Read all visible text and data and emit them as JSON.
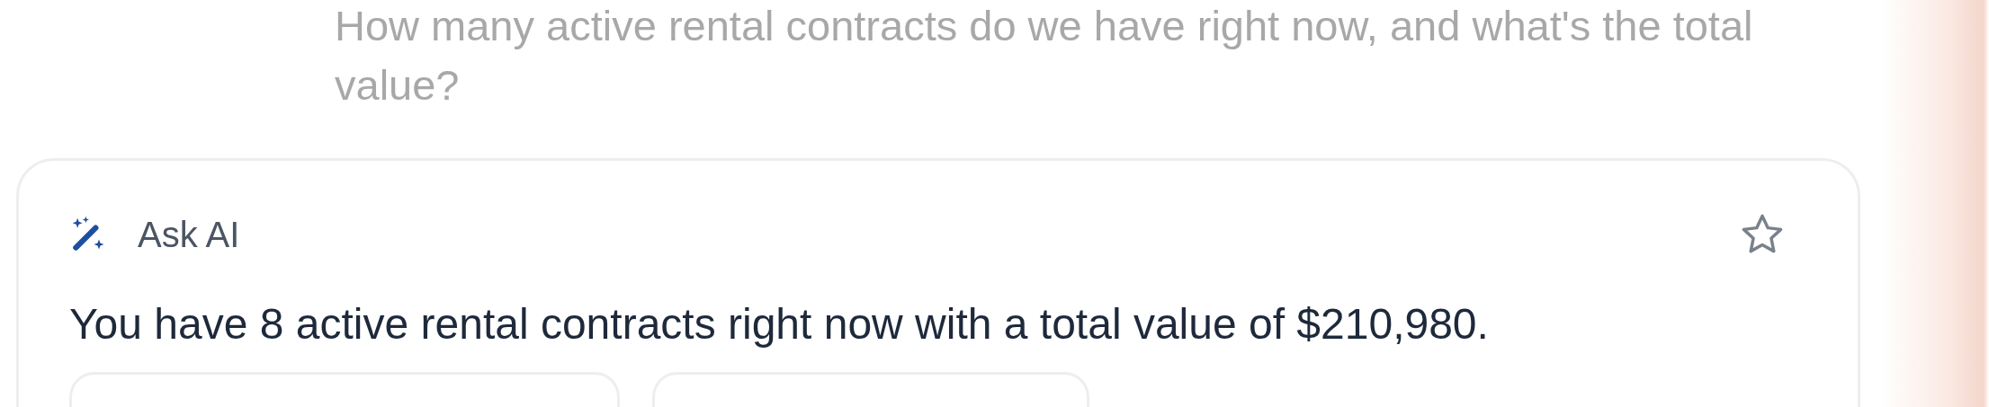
{
  "question": "How many active rental contracts do we have right now, and what's the total value?",
  "answer_card": {
    "title": "Ask AI",
    "favorited": false,
    "answer": "You have 8 active rental contracts right now with a total value of $210,980."
  }
}
